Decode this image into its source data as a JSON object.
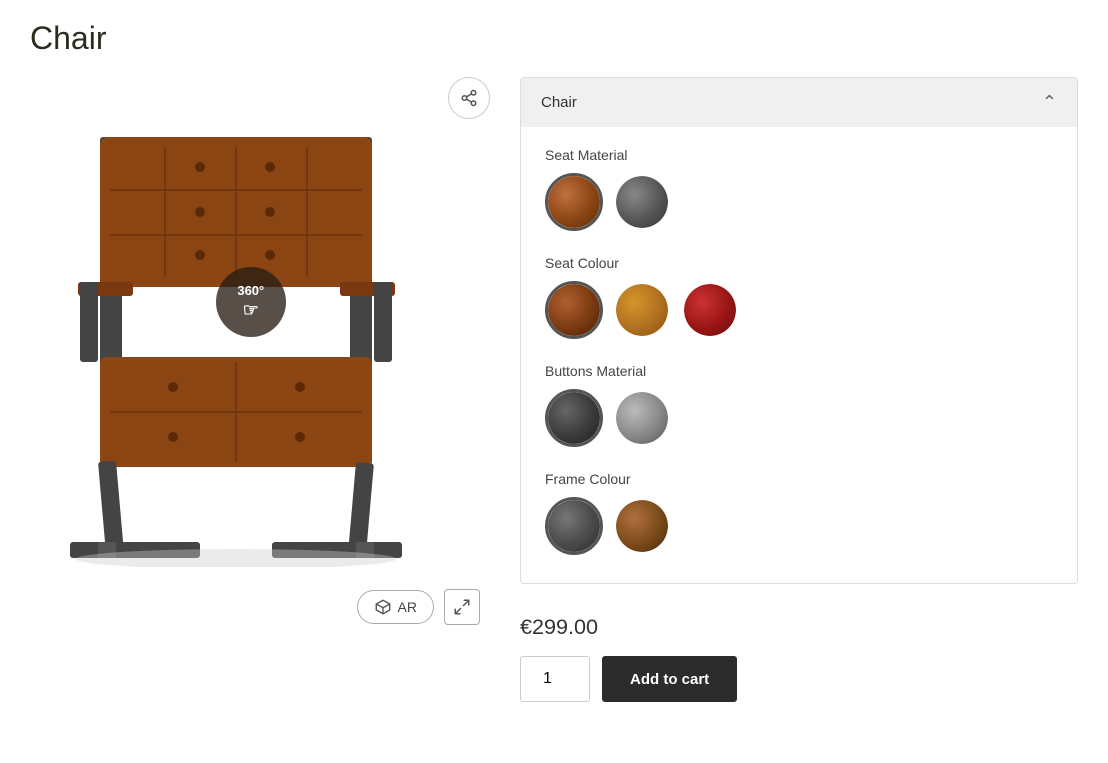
{
  "page": {
    "title": "Chair"
  },
  "image": {
    "badge360": "360°",
    "arLabel": "AR",
    "shareIcon": "share",
    "fullscreenIcon": "⛶"
  },
  "configPanel": {
    "headerLabel": "Chair",
    "collapseIcon": "chevron-up",
    "optionGroups": [
      {
        "id": "seat-material",
        "label": "Seat Material",
        "swatches": [
          {
            "id": "leather-brown",
            "class": "swatch-leather-brown",
            "selected": true
          },
          {
            "id": "fabric-gray",
            "class": "swatch-fabric-gray",
            "selected": false
          }
        ]
      },
      {
        "id": "seat-colour",
        "label": "Seat Colour",
        "swatches": [
          {
            "id": "dark-brown",
            "class": "swatch-dark-brown",
            "selected": true
          },
          {
            "id": "tan",
            "class": "swatch-tan",
            "selected": false
          },
          {
            "id": "red",
            "class": "swatch-red",
            "selected": false
          }
        ]
      },
      {
        "id": "buttons-material",
        "label": "Buttons Material",
        "swatches": [
          {
            "id": "dark-fabric",
            "class": "swatch-dark-fabric",
            "selected": true
          },
          {
            "id": "metal-btn",
            "class": "swatch-metal-btn",
            "selected": false
          }
        ]
      },
      {
        "id": "frame-colour",
        "label": "Frame Colour",
        "swatches": [
          {
            "id": "gunmetal",
            "class": "swatch-gunmetal",
            "selected": true
          },
          {
            "id": "copper",
            "class": "swatch-copper",
            "selected": false
          }
        ]
      }
    ]
  },
  "purchase": {
    "price": "€299.00",
    "quantityValue": "1",
    "addToCartLabel": "Add to cart"
  }
}
